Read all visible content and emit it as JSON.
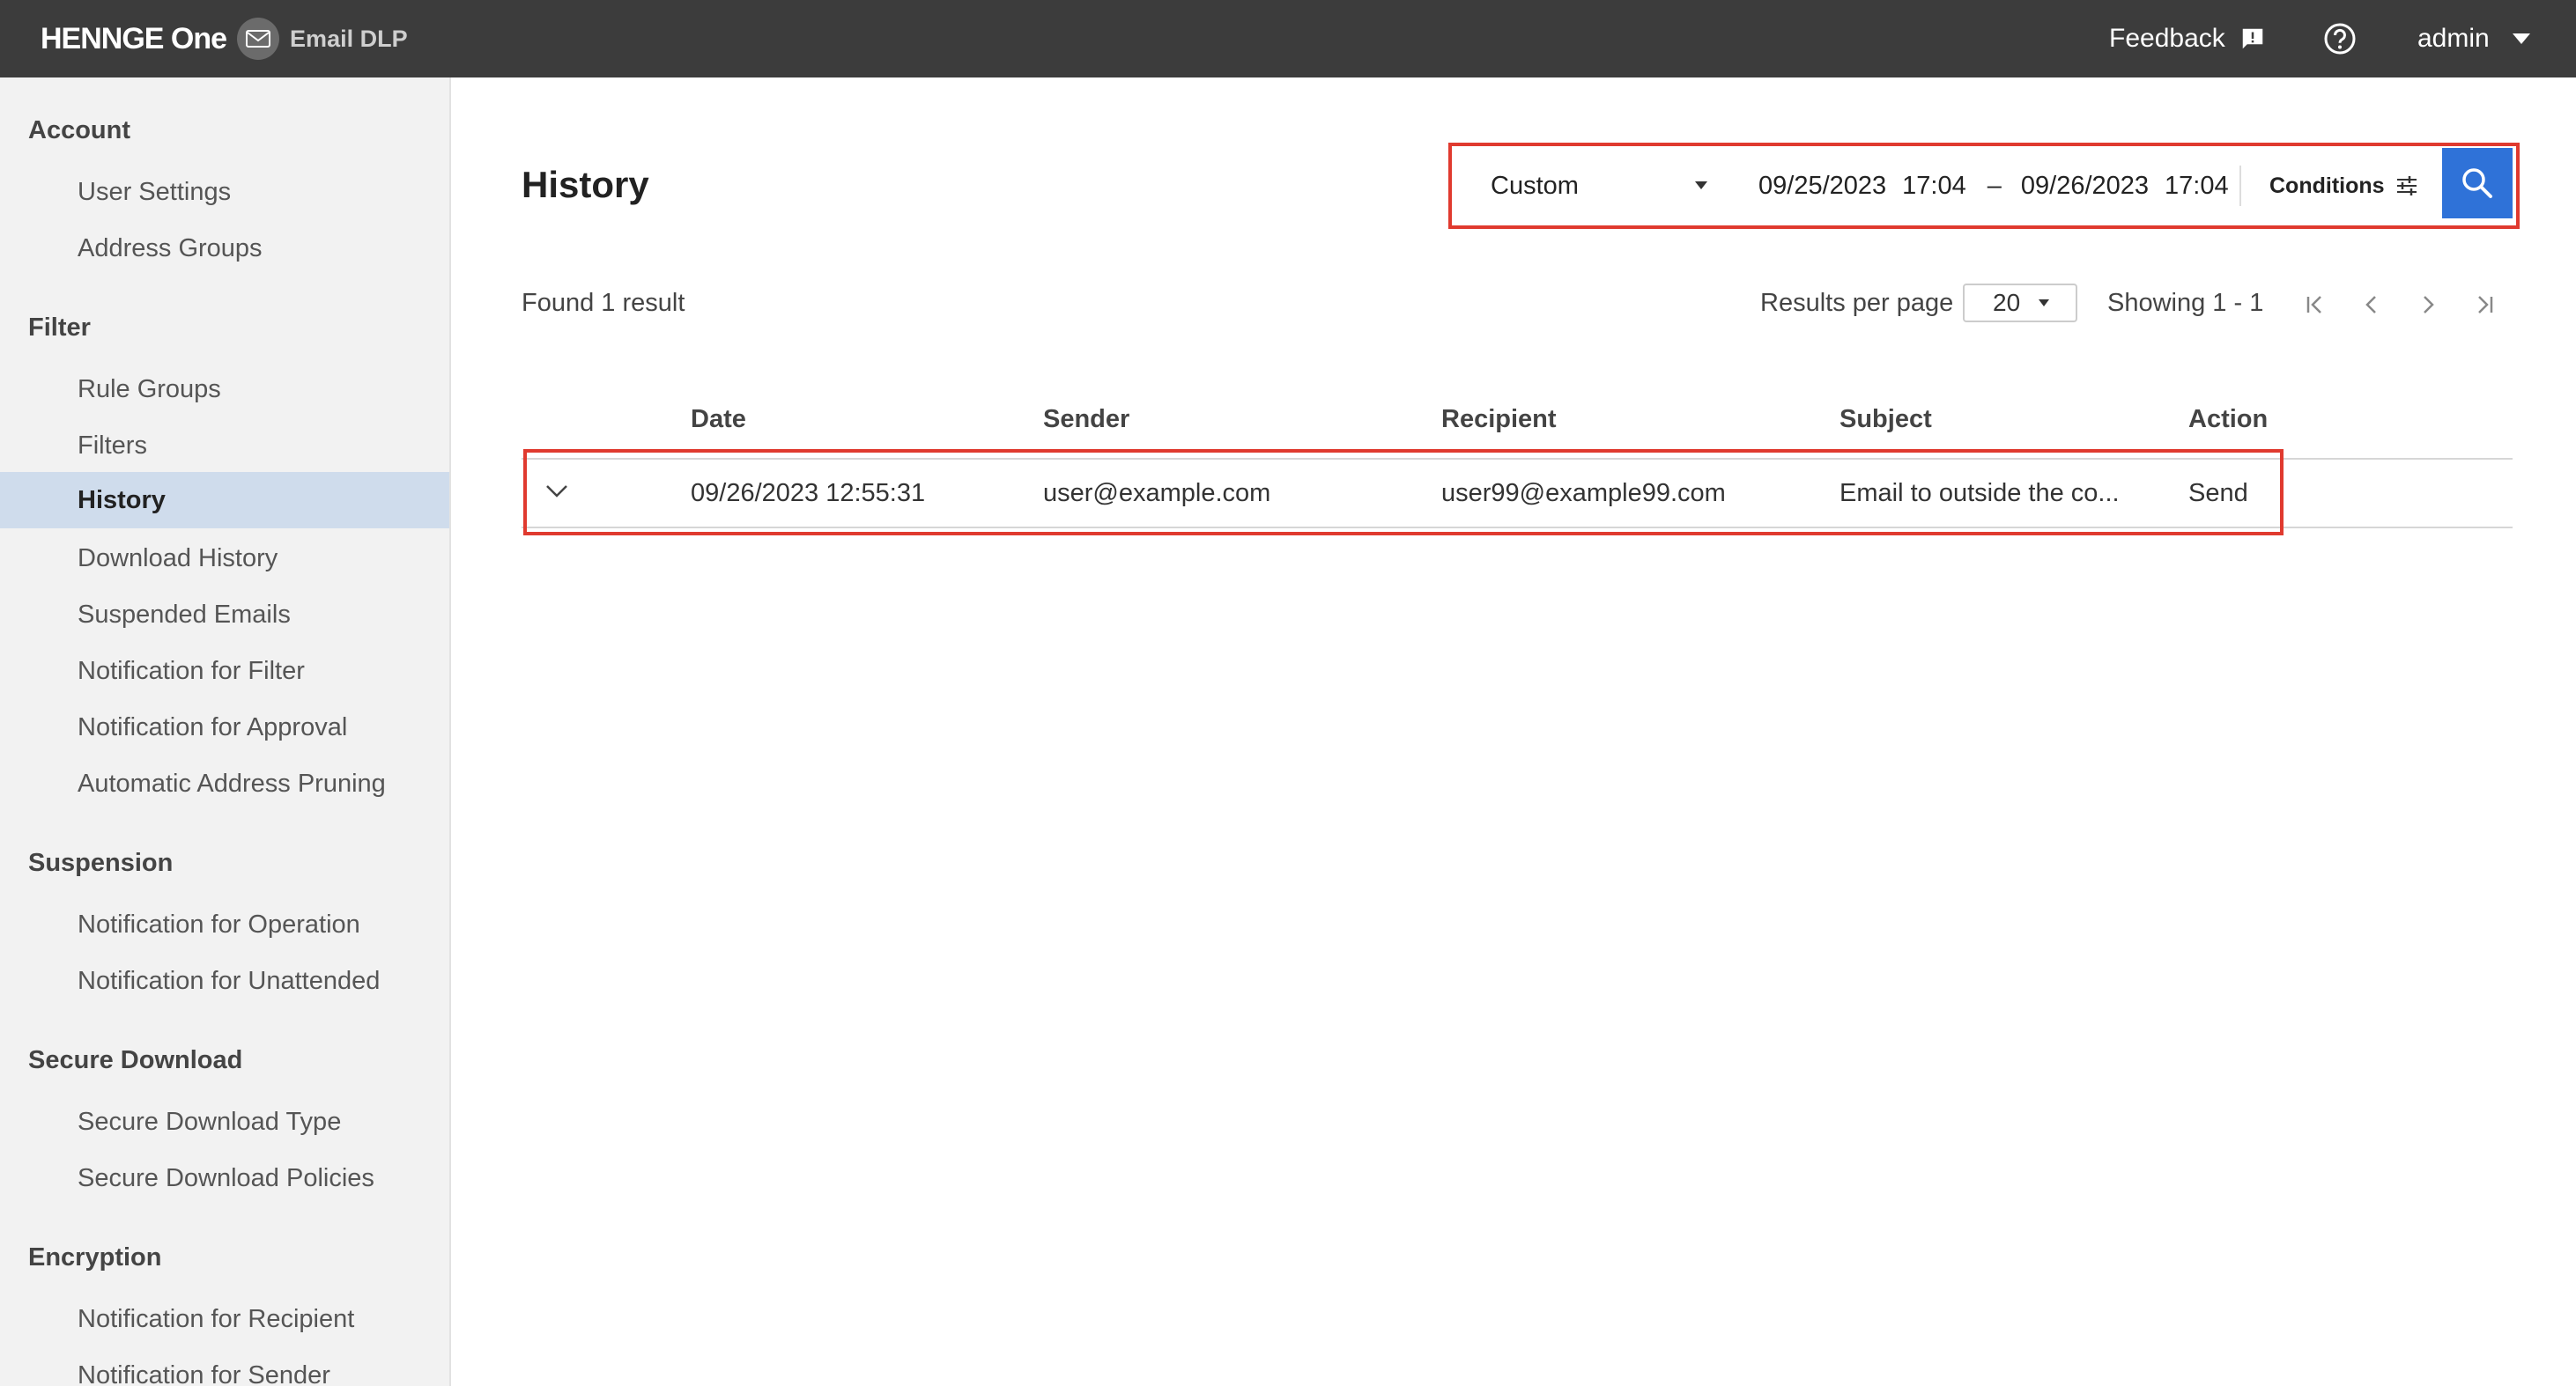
{
  "header": {
    "brand": "HENNGE One",
    "product": "Email DLP",
    "feedback_label": "Feedback",
    "user_label": "admin",
    "icons": [
      "mail-icon",
      "feedback-icon",
      "help-icon",
      "caret-down-icon"
    ]
  },
  "sidebar": {
    "groups": [
      {
        "title": "Account",
        "items": [
          "User Settings",
          "Address Groups"
        ]
      },
      {
        "title": "Filter",
        "items": [
          "Rule Groups",
          "Filters",
          "History",
          "Download History",
          "Suspended Emails",
          "Notification for Filter",
          "Notification for Approval",
          "Automatic Address Pruning"
        ]
      },
      {
        "title": "Suspension",
        "items": [
          "Notification for Operation",
          "Notification for Unattended"
        ]
      },
      {
        "title": "Secure Download",
        "items": [
          "Secure Download Type",
          "Secure Download Policies"
        ]
      },
      {
        "title": "Encryption",
        "items": [
          "Notification for Recipient",
          "Notification for Sender"
        ]
      }
    ],
    "active_item": "History"
  },
  "main": {
    "title": "History",
    "search": {
      "range_value": "Custom",
      "start_date": "09/25/2023",
      "start_time": "17:04",
      "separator": "–",
      "end_date": "09/26/2023",
      "end_time": "17:04",
      "conditions_label": "Conditions"
    },
    "found_text": "Found 1 result",
    "results_per_page_label": "Results per page",
    "results_per_page_value": "20",
    "showing_text": "Showing 1 - 1",
    "table": {
      "columns": [
        "Date",
        "Sender",
        "Recipient",
        "Subject",
        "Action"
      ],
      "rows": [
        {
          "date": "09/26/2023 12:55:31",
          "sender": "user@example.com",
          "recipient": "user99@example99.com",
          "subject": "Email to outside the co...",
          "action": "Send"
        }
      ]
    }
  },
  "colors": {
    "header_bg": "#3c3c3c",
    "sidebar_bg": "#f2f2f2",
    "active_item_bg": "#cfdcec",
    "highlight_border": "#e03a2f",
    "search_button": "#2f72d8"
  }
}
